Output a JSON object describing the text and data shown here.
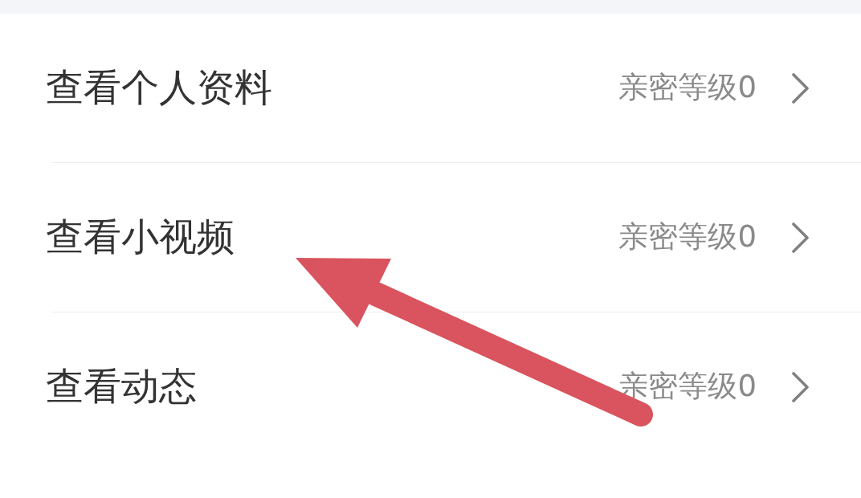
{
  "menu_items": [
    {
      "label": "查看个人资料",
      "value": "亲密等级0"
    },
    {
      "label": "查看小视频",
      "value": "亲密等级0"
    },
    {
      "label": "查看动态",
      "value": "亲密等级0"
    }
  ],
  "annotation": {
    "kind": "arrow"
  }
}
